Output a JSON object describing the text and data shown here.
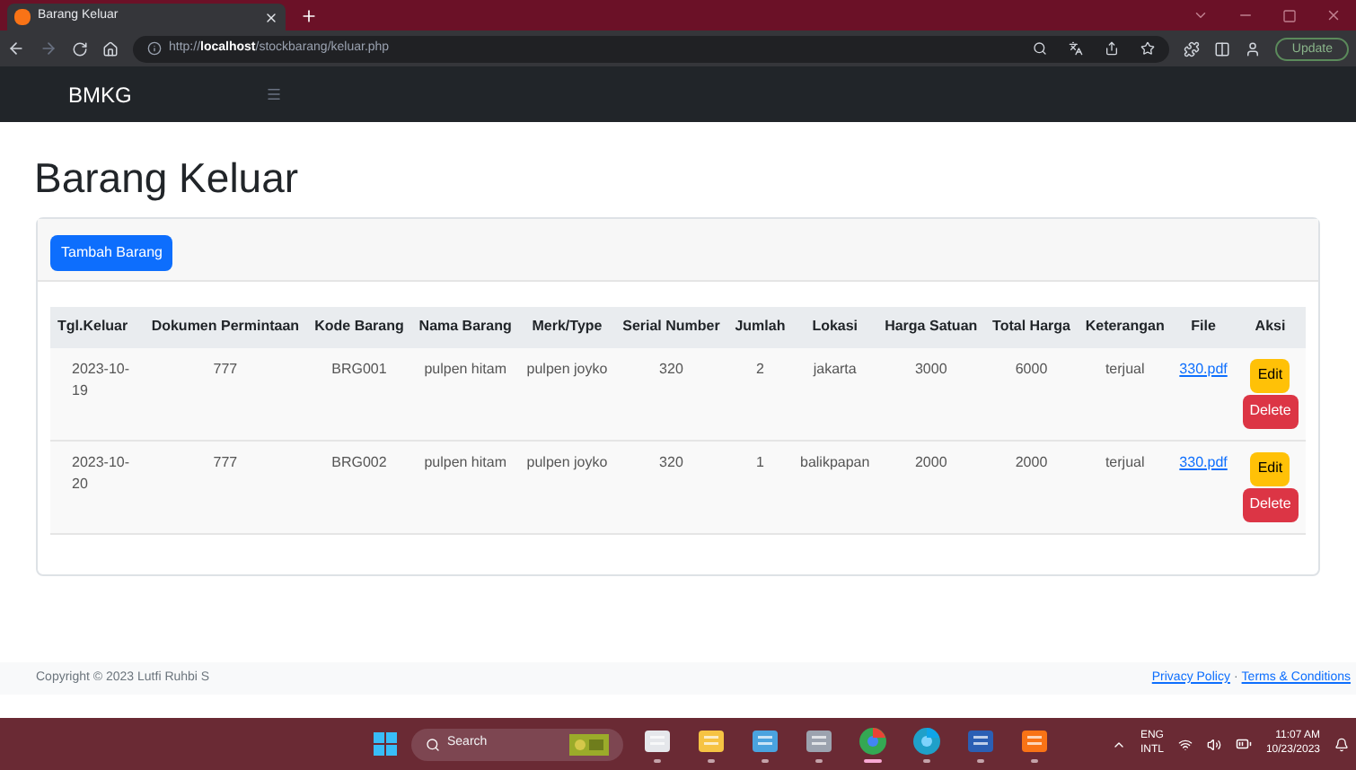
{
  "browser": {
    "tab_title": "Barang Keluar",
    "url": "http://**localhost**/stockbarang/keluar.php",
    "update_button": "Update"
  },
  "navbar": {
    "brand": "BMKG"
  },
  "page_title": "Barang Keluar",
  "add_button": "Tambah Barang",
  "table": {
    "columns": [
      "Tgl.Keluar",
      "Dokumen Permintaan",
      "Kode Barang",
      "Nama Barang",
      "Merk/Type",
      "Serial Number",
      "Jumlah",
      "Lokasi",
      "Harga Satuan",
      "Total Harga",
      "Keterangan",
      "File",
      "Aksi"
    ],
    "rows": [
      {
        "cells": [
          "2023-10-19",
          "777",
          "BRG001",
          "pulpen hitam",
          "pulpen joyko",
          "320",
          "2",
          "jakarta",
          "3000",
          "6000",
          "terjual"
        ],
        "file": "330.pdf",
        "actions": [
          "Edit",
          "Delete"
        ]
      },
      {
        "cells": [
          "2023-10-20",
          "777",
          "BRG002",
          "pulpen hitam",
          "pulpen joyko",
          "320",
          "1",
          "balikpapan",
          "2000",
          "2000",
          "terjual"
        ],
        "file": "330.pdf",
        "actions": [
          "Edit",
          "Delete"
        ]
      }
    ]
  },
  "footer": {
    "copyright": "Copyright © 2023 Lutfi Ruhbi S",
    "links": [
      "Privacy Policy",
      "Terms & Conditions"
    ],
    "separator": "·"
  },
  "taskbar": {
    "search": "Search",
    "apps": [
      {
        "kind": "files",
        "active": false
      },
      {
        "kind": "folder",
        "active": false
      },
      {
        "kind": "notepad",
        "active": false
      },
      {
        "kind": "photos",
        "active": false
      },
      {
        "kind": "chrome",
        "active": true
      },
      {
        "kind": "edge",
        "active": false
      },
      {
        "kind": "word",
        "active": false
      },
      {
        "kind": "xampp",
        "active": false
      }
    ],
    "language": [
      "ENG",
      "INTL"
    ],
    "time": "11:07 AM",
    "date": "10/23/2023"
  }
}
